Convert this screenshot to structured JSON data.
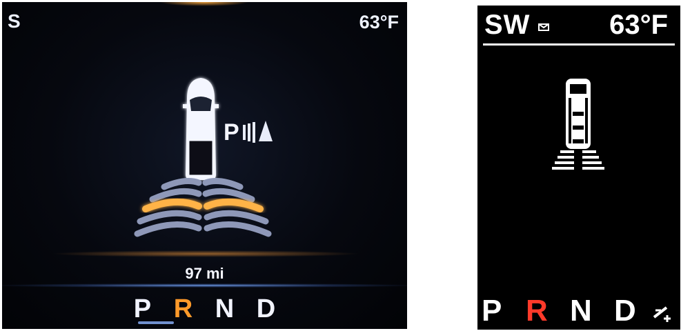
{
  "left_display": {
    "compass": "S",
    "temperature": "63°F",
    "park_assist_label": "P",
    "distance": "97 mi",
    "gears": [
      {
        "label": "P",
        "active": false
      },
      {
        "label": "R",
        "active": true
      },
      {
        "label": "N",
        "active": false
      },
      {
        "label": "D",
        "active": false
      }
    ],
    "colors": {
      "active_gear": "#ff9a2a",
      "sensor_active": "#ffb347",
      "sensor_idle": "#8e98b8"
    }
  },
  "right_display": {
    "compass": "SW",
    "temperature": "63°F",
    "gears": [
      {
        "label": "P",
        "active": false
      },
      {
        "label": "R",
        "active": true
      },
      {
        "label": "N",
        "active": false
      },
      {
        "label": "D",
        "active": false
      }
    ],
    "colors": {
      "active_gear": "#ff3a2a"
    },
    "icons": [
      "envelope-icon",
      "auto-shift-icon"
    ]
  }
}
